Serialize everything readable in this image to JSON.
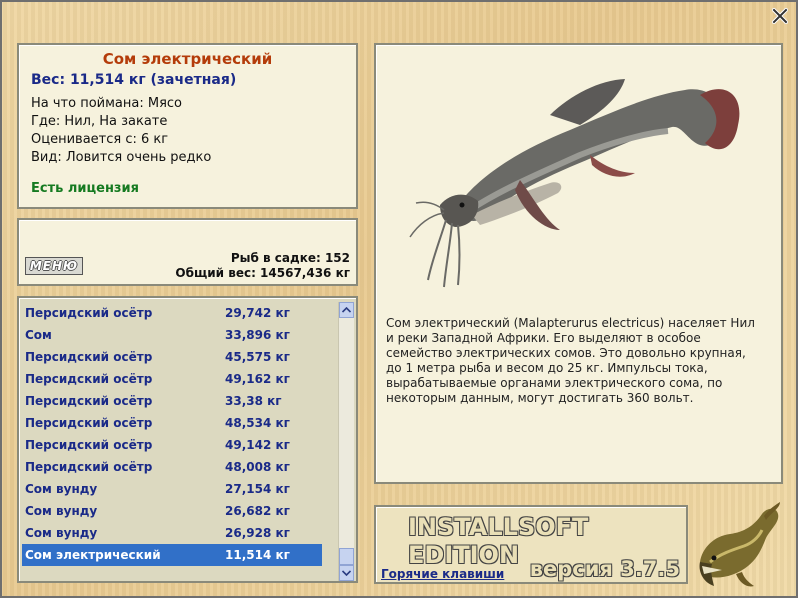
{
  "fish": {
    "title": "Сом электрический",
    "weight": "Вес: 11,514 кг (зачетная)",
    "bait": "На что поймана: Мясо",
    "place": "Где: Нил, На закате",
    "value": "Оценивается с: 6 кг",
    "rarity": "Вид: Ловится очень редко",
    "license": "Есть лицензия",
    "description": "Сом электрический (Malapterurus electricus) населяет Нил и реки Западной Африки. Его выделяют в особое семейство электрических сомов. Это довольно крупная, до 1 метра рыба и весом до 25 кг. Импульсы тока, вырабатываемые органами электрического сома, по некоторым данным, могут достигать 360 вольт."
  },
  "stats": {
    "menu_label": "МЕНЮ",
    "count": "Рыб в садке: 152",
    "total": "Общий вес: 14567,436 кг"
  },
  "catch_list": [
    {
      "name": "Персидский осётр",
      "weight": "29,742 кг"
    },
    {
      "name": "Сом",
      "weight": "33,896 кг"
    },
    {
      "name": "Персидский осётр",
      "weight": "45,575 кг"
    },
    {
      "name": "Персидский осётр",
      "weight": "49,162 кг"
    },
    {
      "name": "Персидский осётр",
      "weight": "33,38 кг"
    },
    {
      "name": "Персидский осётр",
      "weight": "48,534 кг"
    },
    {
      "name": "Персидский осётр",
      "weight": "49,142 кг"
    },
    {
      "name": "Персидский осётр",
      "weight": "48,008 кг"
    },
    {
      "name": "Сом вунду",
      "weight": "27,154 кг"
    },
    {
      "name": "Сом вунду",
      "weight": "26,682 кг"
    },
    {
      "name": "Сом вунду",
      "weight": "26,928 кг"
    },
    {
      "name": "Сом электрический",
      "weight": "11,514 кг",
      "selected": true
    }
  ],
  "brand": {
    "edition": "INSTALLSOFT EDITION",
    "version": "версия 3.7.5",
    "hotkeys": "Горячие клавиши"
  },
  "icons": {
    "close": "close-icon",
    "scroll_up": "chevron-up-icon",
    "scroll_down": "chevron-down-icon"
  },
  "colors": {
    "title": "#b43c0a",
    "link": "#1a2a88",
    "license": "#157a20",
    "selection": "#3170c8"
  }
}
